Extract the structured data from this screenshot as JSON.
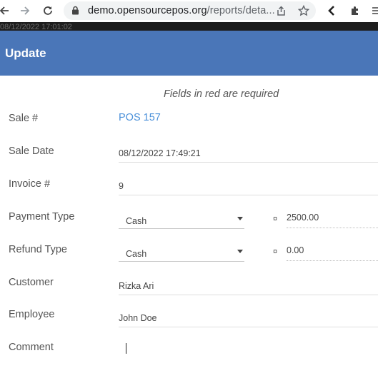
{
  "browser": {
    "url_host": "demo.opensourcepos.org",
    "url_path": "/reports/deta..."
  },
  "background_strip_text": "08/12/2022 17:01:02",
  "modal": {
    "title": "Update",
    "required_note": "Fields in red are required"
  },
  "form": {
    "sale_number": {
      "label": "Sale #",
      "value": "POS 157"
    },
    "sale_date": {
      "label": "Sale Date",
      "value": "08/12/2022 17:49:21"
    },
    "invoice": {
      "label": "Invoice #",
      "value": "9"
    },
    "payment_type": {
      "label": "Payment Type",
      "selected": "Cash",
      "currency_symbol": "¤",
      "amount": "2500.00"
    },
    "refund_type": {
      "label": "Refund Type",
      "selected": "Cash",
      "currency_symbol": "¤",
      "amount": "0.00"
    },
    "customer": {
      "label": "Customer",
      "value": "Rizka Ari"
    },
    "employee": {
      "label": "Employee",
      "value": "John Doe"
    },
    "comment": {
      "label": "Comment",
      "value": ""
    }
  },
  "colors": {
    "header": "#4a76b8",
    "link": "#4a90d9"
  }
}
